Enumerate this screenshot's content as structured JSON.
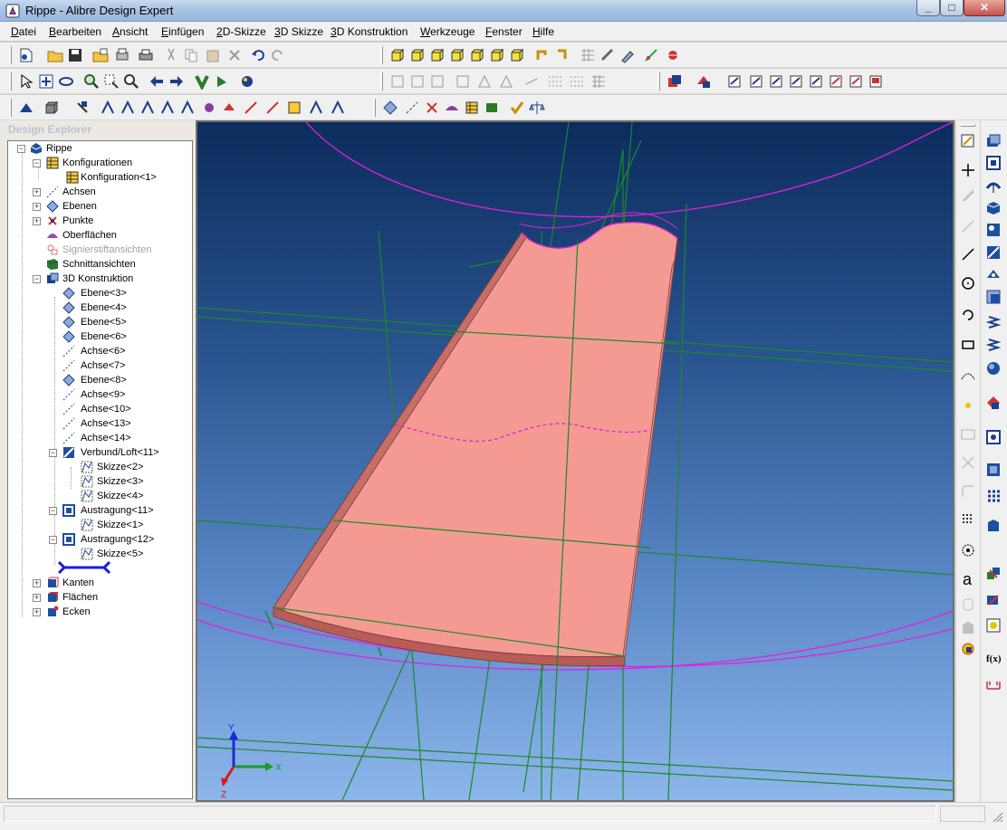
{
  "window": {
    "title": "Rippe - Alibre Design Expert",
    "icon": "alibre-app-icon"
  },
  "menu": [
    "Datei",
    "Bearbeiten",
    "Ansicht",
    "Einfügen",
    "2D-Skizze",
    "3D Skizze",
    "3D Konstruktion",
    "Werkzeuge",
    "Fenster",
    "Hilfe"
  ],
  "explorer": {
    "title": "Design Explorer",
    "tree": {
      "root": "Rippe",
      "konfigurationen": "Konfigurationen",
      "konfiguration1": "Konfiguration<1>",
      "achsen": "Achsen",
      "ebenen": "Ebenen",
      "punkte": "Punkte",
      "oberflaechen": "Oberflächen",
      "signierstift": "Signierstiftansichten",
      "schnitt": "Schnittansichten",
      "konstruktion": "3D Konstruktion",
      "ebene3": "Ebene<3>",
      "ebene4": "Ebene<4>",
      "ebene5": "Ebene<5>",
      "ebene6": "Ebene<6>",
      "achse6": "Achse<6>",
      "achse7": "Achse<7>",
      "ebene8": "Ebene<8>",
      "achse9": "Achse<9>",
      "achse10": "Achse<10>",
      "achse13": "Achse<13>",
      "achse14": "Achse<14>",
      "loft11": "Verbund/Loft<11>",
      "skizze2": "Skizze<2>",
      "skizze3": "Skizze<3>",
      "skizze4": "Skizze<4>",
      "austragung11": "Austragung<11>",
      "skizze1": "Skizze<1>",
      "austragung12": "Austragung<12>",
      "skizze5": "Skizze<5>",
      "kanten": "Kanten",
      "flaechen": "Flächen",
      "ecken": "Ecken"
    }
  },
  "viewport": {
    "part_color": "#f59a92",
    "edge_color": "#7a3a38",
    "construction_line_color": "#1a8a2a",
    "sketch_color": "#e020e0",
    "triad": {
      "x": "X",
      "y": "Y",
      "z": "Z"
    }
  },
  "statusbar": {
    "left": "",
    "right": ""
  }
}
